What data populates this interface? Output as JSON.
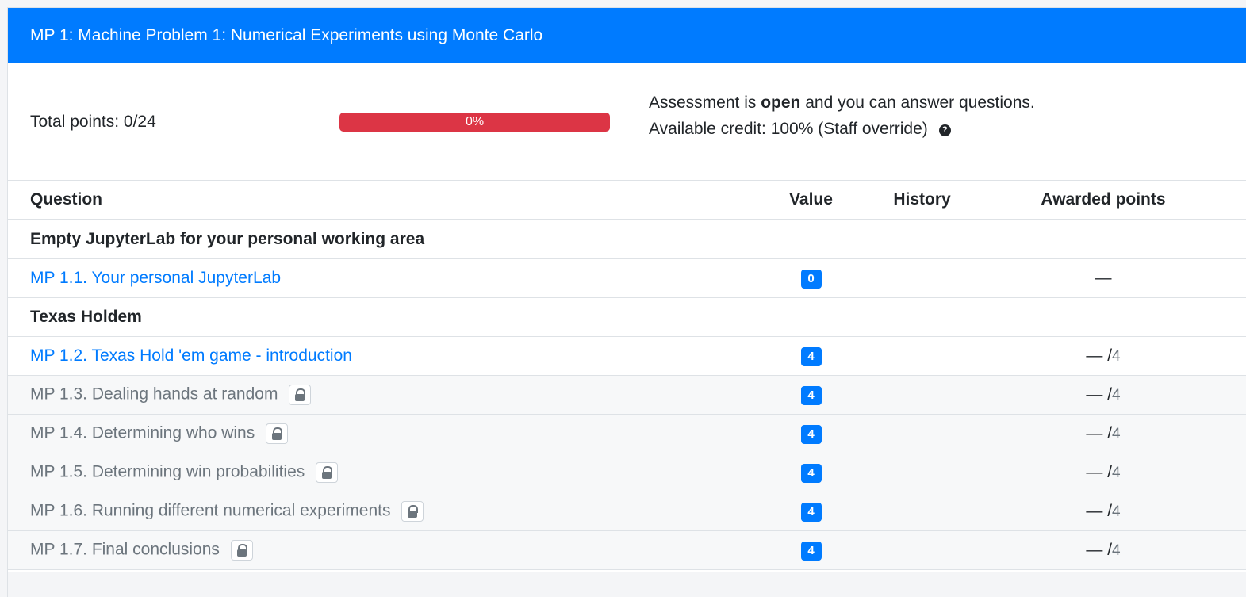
{
  "header": {
    "title": "MP 1: Machine Problem 1: Numerical Experiments using Monte Carlo"
  },
  "summary": {
    "total_points": "Total points: 0/24",
    "progress_percent": 0,
    "progress_label": "0%",
    "status_prefix": "Assessment is ",
    "status_state": "open",
    "status_suffix": " and you can answer questions.",
    "credit": "Available credit: 100% (Staff override)",
    "help_icon": "question-circle-icon"
  },
  "table": {
    "headers": {
      "question": "Question",
      "value": "Value",
      "history": "History",
      "awarded": "Awarded points"
    },
    "groups": [
      {
        "title": "Empty JupyterLab for your personal working area",
        "rows": [
          {
            "label": "MP 1.1. Your personal JupyterLab",
            "value": "0",
            "awarded": "—",
            "max": ""
          }
        ]
      },
      {
        "title": "Texas Holdem",
        "rows": [
          {
            "label": "MP 1.2. Texas Hold 'em game - introduction",
            "value": "4",
            "awarded": "— /",
            "max": "4"
          },
          {
            "label": "MP 1.3. Dealing hands at random",
            "value": "4",
            "awarded": "— /",
            "max": "4"
          },
          {
            "label": "MP 1.4. Determining who wins",
            "value": "4",
            "awarded": "— /",
            "max": "4"
          },
          {
            "label": "MP 1.5. Determining win probabilities",
            "value": "4",
            "awarded": "— /",
            "max": "4"
          },
          {
            "label": "MP 1.6. Running different numerical experiments",
            "value": "4",
            "awarded": "— /",
            "max": "4"
          },
          {
            "label": "MP 1.7. Final conclusions",
            "value": "4",
            "awarded": "— /",
            "max": "4"
          }
        ]
      }
    ]
  },
  "colors": {
    "primary": "#007bff",
    "danger": "#dc3545",
    "muted": "#6c757d"
  }
}
